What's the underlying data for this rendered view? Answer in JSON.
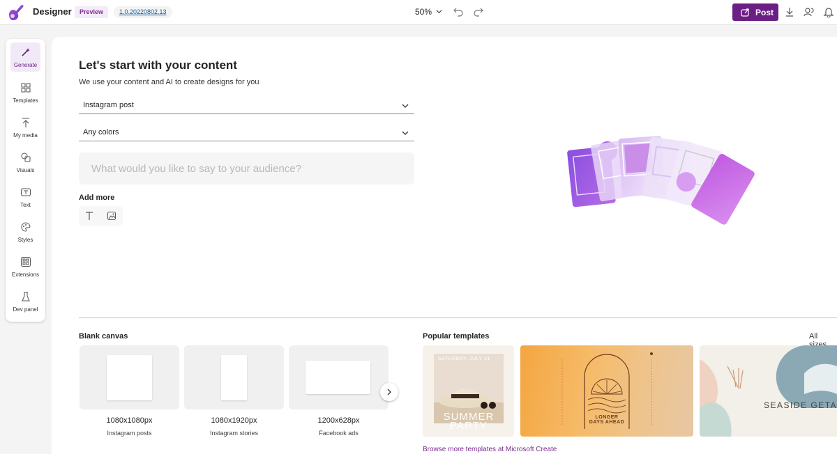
{
  "app": {
    "name": "Designer",
    "preview_label": "Preview",
    "version": "1.0.20220802.13",
    "zoom": "50%",
    "post_label": "Post"
  },
  "sidebar": {
    "items": [
      {
        "label": "Generate",
        "icon": "wand-icon",
        "active": true
      },
      {
        "label": "Templates",
        "icon": "templates-icon"
      },
      {
        "label": "My media",
        "icon": "upload-icon"
      },
      {
        "label": "Visuals",
        "icon": "shapes-icon"
      },
      {
        "label": "Text",
        "icon": "text-icon"
      },
      {
        "label": "Styles",
        "icon": "palette-icon"
      },
      {
        "label": "Extensions",
        "icon": "apps-icon"
      },
      {
        "label": "Dev panel",
        "icon": "flask-icon"
      }
    ]
  },
  "generate": {
    "title": "Let's start with your content",
    "subtitle": "We use your content and AI to create designs for you",
    "format_value": "Instagram post",
    "color_value": "Any colors",
    "prompt_placeholder": "What would you like to say to your audience?",
    "add_more_label": "Add more"
  },
  "blank_canvas": {
    "heading": "Blank canvas",
    "cards": [
      {
        "size": "1080x1080px",
        "name": "Instagram posts"
      },
      {
        "size": "1080x1920px",
        "name": "Instagram stories"
      },
      {
        "size": "1200x628px",
        "name": "Facebook ads"
      }
    ]
  },
  "popular_templates": {
    "heading": "Popular templates",
    "all_sizes": "All sizes",
    "browse_link": "Browse more templates at Microsoft Create",
    "items": [
      {
        "top_text": "SATURDAY, JULY 31",
        "main_text": "SUMMER PARTY"
      },
      {
        "main_text": "LONGER DAYS AHEAD"
      },
      {
        "main_text": "SEASIDE GETA"
      }
    ]
  },
  "colors": {
    "accent": "#6b1f85",
    "preview_badge_bg": "#f4ebf8"
  }
}
